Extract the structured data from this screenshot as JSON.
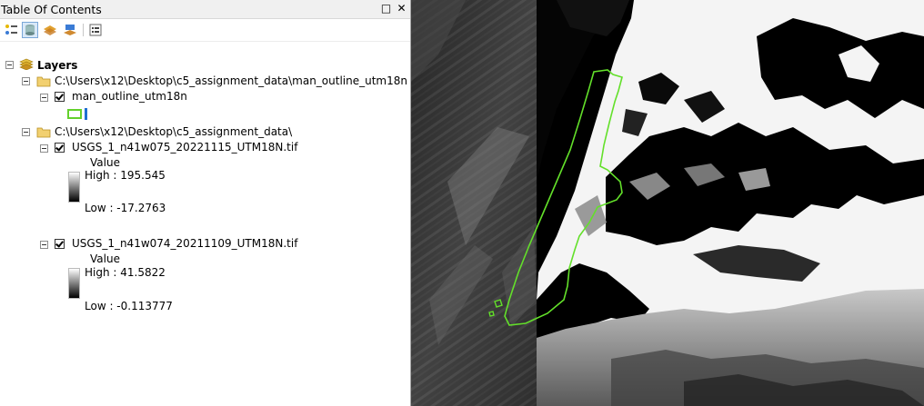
{
  "panel": {
    "title": "Table Of Contents",
    "maximize_glyph": "□",
    "close_glyph": "✕"
  },
  "toolbar": {
    "buttons": [
      {
        "icon": "list-by-drawing-order-icon"
      },
      {
        "icon": "list-by-source-icon"
      },
      {
        "icon": "list-by-visibility-icon"
      },
      {
        "icon": "list-by-selection-icon"
      },
      {
        "icon": "options-icon"
      }
    ]
  },
  "tree": {
    "root_label": "Layers",
    "group1": {
      "path": "C:\\Users\\x12\\Desktop\\c5_assignment_data\\man_outline_utm18n",
      "layer": {
        "name": "man_outline_utm18n",
        "symbol_color": "#63d12b"
      }
    },
    "group2": {
      "path": "C:\\Users\\x12\\Desktop\\c5_assignment_data\\",
      "layer1": {
        "name": "USGS_1_n41w075_20221115_UTM18N.tif",
        "value_label": "Value",
        "high": "High : 195.545",
        "low": "Low : -17.2763"
      },
      "layer2": {
        "name": "USGS_1_n41w074_20211109_UTM18N.tif",
        "value_label": "Value",
        "high": "High : 41.5822",
        "low": "Low : -0.113777"
      }
    }
  },
  "map": {
    "outline_color": "#63e02a"
  }
}
